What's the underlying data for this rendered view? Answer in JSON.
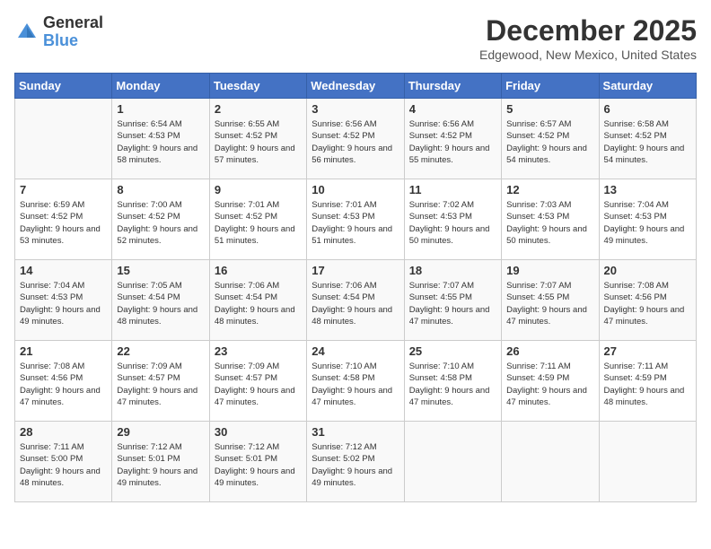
{
  "header": {
    "logo_line1": "General",
    "logo_line2": "Blue",
    "month_year": "December 2025",
    "location": "Edgewood, New Mexico, United States"
  },
  "weekdays": [
    "Sunday",
    "Monday",
    "Tuesday",
    "Wednesday",
    "Thursday",
    "Friday",
    "Saturday"
  ],
  "weeks": [
    [
      {
        "day": "",
        "sunrise": "",
        "sunset": "",
        "daylight": ""
      },
      {
        "day": "1",
        "sunrise": "Sunrise: 6:54 AM",
        "sunset": "Sunset: 4:53 PM",
        "daylight": "Daylight: 9 hours and 58 minutes."
      },
      {
        "day": "2",
        "sunrise": "Sunrise: 6:55 AM",
        "sunset": "Sunset: 4:52 PM",
        "daylight": "Daylight: 9 hours and 57 minutes."
      },
      {
        "day": "3",
        "sunrise": "Sunrise: 6:56 AM",
        "sunset": "Sunset: 4:52 PM",
        "daylight": "Daylight: 9 hours and 56 minutes."
      },
      {
        "day": "4",
        "sunrise": "Sunrise: 6:56 AM",
        "sunset": "Sunset: 4:52 PM",
        "daylight": "Daylight: 9 hours and 55 minutes."
      },
      {
        "day": "5",
        "sunrise": "Sunrise: 6:57 AM",
        "sunset": "Sunset: 4:52 PM",
        "daylight": "Daylight: 9 hours and 54 minutes."
      },
      {
        "day": "6",
        "sunrise": "Sunrise: 6:58 AM",
        "sunset": "Sunset: 4:52 PM",
        "daylight": "Daylight: 9 hours and 54 minutes."
      }
    ],
    [
      {
        "day": "7",
        "sunrise": "Sunrise: 6:59 AM",
        "sunset": "Sunset: 4:52 PM",
        "daylight": "Daylight: 9 hours and 53 minutes."
      },
      {
        "day": "8",
        "sunrise": "Sunrise: 7:00 AM",
        "sunset": "Sunset: 4:52 PM",
        "daylight": "Daylight: 9 hours and 52 minutes."
      },
      {
        "day": "9",
        "sunrise": "Sunrise: 7:01 AM",
        "sunset": "Sunset: 4:52 PM",
        "daylight": "Daylight: 9 hours and 51 minutes."
      },
      {
        "day": "10",
        "sunrise": "Sunrise: 7:01 AM",
        "sunset": "Sunset: 4:53 PM",
        "daylight": "Daylight: 9 hours and 51 minutes."
      },
      {
        "day": "11",
        "sunrise": "Sunrise: 7:02 AM",
        "sunset": "Sunset: 4:53 PM",
        "daylight": "Daylight: 9 hours and 50 minutes."
      },
      {
        "day": "12",
        "sunrise": "Sunrise: 7:03 AM",
        "sunset": "Sunset: 4:53 PM",
        "daylight": "Daylight: 9 hours and 50 minutes."
      },
      {
        "day": "13",
        "sunrise": "Sunrise: 7:04 AM",
        "sunset": "Sunset: 4:53 PM",
        "daylight": "Daylight: 9 hours and 49 minutes."
      }
    ],
    [
      {
        "day": "14",
        "sunrise": "Sunrise: 7:04 AM",
        "sunset": "Sunset: 4:53 PM",
        "daylight": "Daylight: 9 hours and 49 minutes."
      },
      {
        "day": "15",
        "sunrise": "Sunrise: 7:05 AM",
        "sunset": "Sunset: 4:54 PM",
        "daylight": "Daylight: 9 hours and 48 minutes."
      },
      {
        "day": "16",
        "sunrise": "Sunrise: 7:06 AM",
        "sunset": "Sunset: 4:54 PM",
        "daylight": "Daylight: 9 hours and 48 minutes."
      },
      {
        "day": "17",
        "sunrise": "Sunrise: 7:06 AM",
        "sunset": "Sunset: 4:54 PM",
        "daylight": "Daylight: 9 hours and 48 minutes."
      },
      {
        "day": "18",
        "sunrise": "Sunrise: 7:07 AM",
        "sunset": "Sunset: 4:55 PM",
        "daylight": "Daylight: 9 hours and 47 minutes."
      },
      {
        "day": "19",
        "sunrise": "Sunrise: 7:07 AM",
        "sunset": "Sunset: 4:55 PM",
        "daylight": "Daylight: 9 hours and 47 minutes."
      },
      {
        "day": "20",
        "sunrise": "Sunrise: 7:08 AM",
        "sunset": "Sunset: 4:56 PM",
        "daylight": "Daylight: 9 hours and 47 minutes."
      }
    ],
    [
      {
        "day": "21",
        "sunrise": "Sunrise: 7:08 AM",
        "sunset": "Sunset: 4:56 PM",
        "daylight": "Daylight: 9 hours and 47 minutes."
      },
      {
        "day": "22",
        "sunrise": "Sunrise: 7:09 AM",
        "sunset": "Sunset: 4:57 PM",
        "daylight": "Daylight: 9 hours and 47 minutes."
      },
      {
        "day": "23",
        "sunrise": "Sunrise: 7:09 AM",
        "sunset": "Sunset: 4:57 PM",
        "daylight": "Daylight: 9 hours and 47 minutes."
      },
      {
        "day": "24",
        "sunrise": "Sunrise: 7:10 AM",
        "sunset": "Sunset: 4:58 PM",
        "daylight": "Daylight: 9 hours and 47 minutes."
      },
      {
        "day": "25",
        "sunrise": "Sunrise: 7:10 AM",
        "sunset": "Sunset: 4:58 PM",
        "daylight": "Daylight: 9 hours and 47 minutes."
      },
      {
        "day": "26",
        "sunrise": "Sunrise: 7:11 AM",
        "sunset": "Sunset: 4:59 PM",
        "daylight": "Daylight: 9 hours and 47 minutes."
      },
      {
        "day": "27",
        "sunrise": "Sunrise: 7:11 AM",
        "sunset": "Sunset: 4:59 PM",
        "daylight": "Daylight: 9 hours and 48 minutes."
      }
    ],
    [
      {
        "day": "28",
        "sunrise": "Sunrise: 7:11 AM",
        "sunset": "Sunset: 5:00 PM",
        "daylight": "Daylight: 9 hours and 48 minutes."
      },
      {
        "day": "29",
        "sunrise": "Sunrise: 7:12 AM",
        "sunset": "Sunset: 5:01 PM",
        "daylight": "Daylight: 9 hours and 49 minutes."
      },
      {
        "day": "30",
        "sunrise": "Sunrise: 7:12 AM",
        "sunset": "Sunset: 5:01 PM",
        "daylight": "Daylight: 9 hours and 49 minutes."
      },
      {
        "day": "31",
        "sunrise": "Sunrise: 7:12 AM",
        "sunset": "Sunset: 5:02 PM",
        "daylight": "Daylight: 9 hours and 49 minutes."
      },
      {
        "day": "",
        "sunrise": "",
        "sunset": "",
        "daylight": ""
      },
      {
        "day": "",
        "sunrise": "",
        "sunset": "",
        "daylight": ""
      },
      {
        "day": "",
        "sunrise": "",
        "sunset": "",
        "daylight": ""
      }
    ]
  ]
}
